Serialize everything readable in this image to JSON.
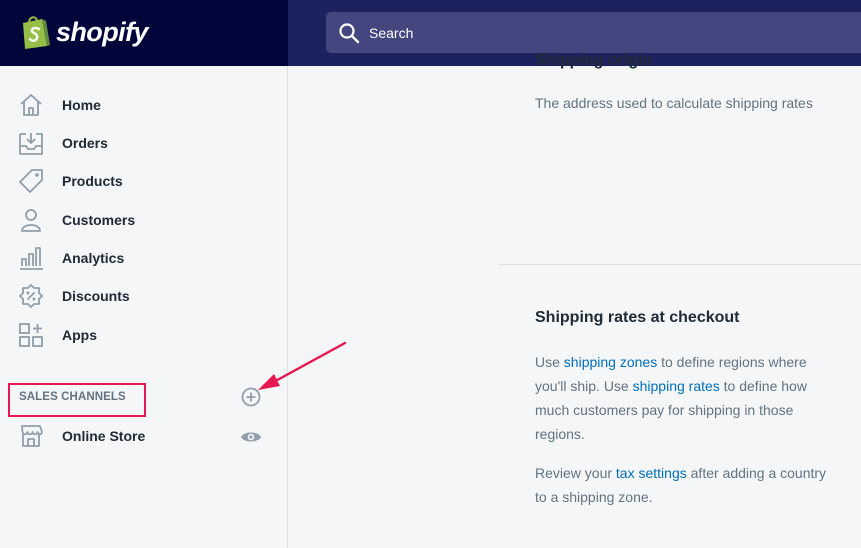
{
  "brand": {
    "name": "shopify"
  },
  "search": {
    "label": "Search"
  },
  "sidebar": {
    "items": [
      {
        "label": "Home",
        "icon": "home-icon"
      },
      {
        "label": "Orders",
        "icon": "orders-icon"
      },
      {
        "label": "Products",
        "icon": "tag-icon"
      },
      {
        "label": "Customers",
        "icon": "person-icon"
      },
      {
        "label": "Analytics",
        "icon": "bar-chart-icon"
      },
      {
        "label": "Discounts",
        "icon": "discount-icon"
      },
      {
        "label": "Apps",
        "icon": "apps-grid-icon"
      }
    ],
    "sales_channels": {
      "heading": "SALES CHANNELS",
      "channels": [
        {
          "label": "Online Store",
          "icon": "store-icon"
        }
      ]
    }
  },
  "main": {
    "shipping_origin": {
      "title_partial": "Shipping origin",
      "description": "The address used to calculate shipping rates"
    },
    "shipping_rates": {
      "heading": "Shipping rates at checkout",
      "p1": {
        "t1": "Use ",
        "link1": "shipping zones",
        "t2": " to define regions where you'll ship. Use ",
        "link2": "shipping rates",
        "t3": " to define how much customers pay for shipping in those regions."
      },
      "p2": {
        "t1": "Review your ",
        "link1": "tax settings",
        "t2": " after adding a country to a shipping zone."
      }
    }
  },
  "colors": {
    "brand_bar": "#000639",
    "top_bar": "#1c2260",
    "link": "#006fbb",
    "highlight": "#e8174f",
    "logo_green": "#95bf47"
  }
}
